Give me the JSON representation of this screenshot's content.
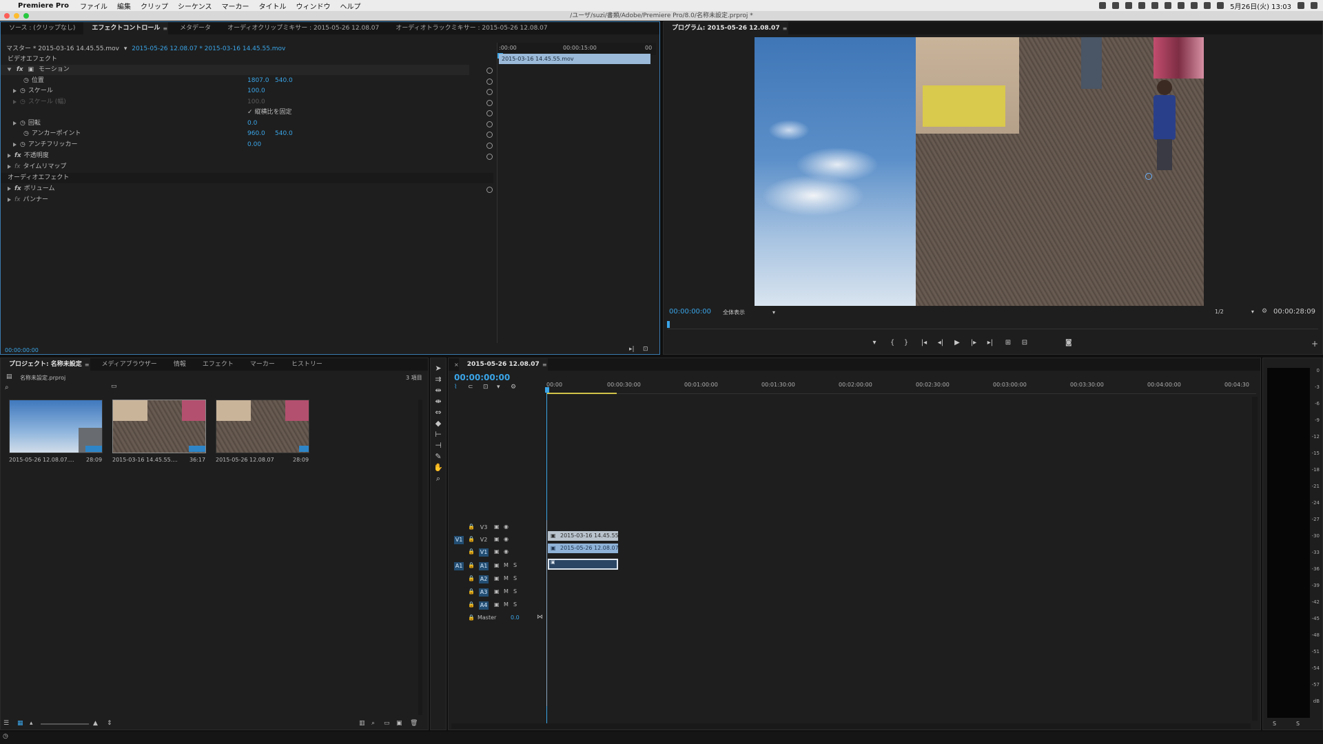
{
  "menubar": {
    "app": "Premiere Pro",
    "items": [
      "ファイル",
      "編集",
      "クリップ",
      "シーケンス",
      "マーカー",
      "タイトル",
      "ウィンドウ",
      "ヘルプ"
    ],
    "clock": "5月26日(火) 13:03"
  },
  "window": {
    "title": "/ユーザ/suzi/書類/Adobe/Premiere Pro/8.0/名称未設定.prproj *"
  },
  "source_panel": {
    "tabs": [
      "ソース : (クリップなし)",
      "エフェクトコントロール",
      "メタデータ",
      "オーディオクリップミキサー : 2015-05-26 12.08.07",
      "オーディオトラックミキサー : 2015-05-26 12.08.07"
    ],
    "active_tab": 1,
    "master_label": "マスター * 2015-03-16 14.45.55.mov",
    "sequence_clip": "2015-05-26 12.08.07 * 2015-03-16 14.45.55.mov",
    "video_effects_header": "ビデオエフェクト",
    "motion": "モーション",
    "position_label": "位置",
    "position_x": "1807.0",
    "position_y": "540.0",
    "scale_label": "スケール",
    "scale_value": "100.0",
    "scale_width_label": "スケール (幅)",
    "scale_width_value": "100.0",
    "uniform_scale": "縦横比を固定",
    "rotation_label": "回転",
    "rotation_value": "0.0",
    "anchor_label": "アンカーポイント",
    "anchor_x": "960.0",
    "anchor_y": "540.0",
    "flicker_label": "アンチフリッカー",
    "flicker_value": "0.00",
    "opacity": "不透明度",
    "time_remap": "タイムリマップ",
    "audio_effects_header": "オーディオエフェクト",
    "volume": "ボリューム",
    "panner": "パンナー",
    "timecode": "00:00:00:00",
    "mini_timeline_start": ":00:00",
    "mini_timeline_mid": "00:00:15:00",
    "mini_timeline_end": "00",
    "mini_clip": "2015-03-16 14.45.55.mov"
  },
  "program_panel": {
    "title": "プログラム: 2015-05-26 12.08.07",
    "timecode_left": "00:00:00:00",
    "fit": "全体表示",
    "resolution": "1/2",
    "timecode_right": "00:00:28:09"
  },
  "project_panel": {
    "tabs": [
      "プロジェクト: 名称未設定",
      "メディアブラウザー",
      "情報",
      "エフェクト",
      "マーカー",
      "ヒストリー"
    ],
    "project_file": "名称未設定.prproj",
    "item_count": "3 項目",
    "items": [
      {
        "name": "2015-05-26 12.08.07....",
        "duration": "28:09"
      },
      {
        "name": "2015-03-16 14.45.55....",
        "duration": "36:17"
      },
      {
        "name": "2015-05-26 12.08.07",
        "duration": "28:09"
      }
    ]
  },
  "timeline_panel": {
    "title": "2015-05-26 12.08.07",
    "timecode": "00:00:00:00",
    "ruler": [
      "00:00",
      "00:00:30:00",
      "00:01:00:00",
      "00:01:30:00",
      "00:02:00:00",
      "00:02:30:00",
      "00:03:00:00",
      "00:03:30:00",
      "00:04:00:00",
      "00:04:30"
    ],
    "tracks": [
      {
        "name": "V3",
        "src": "",
        "kind": "video"
      },
      {
        "name": "V2",
        "src": "V1",
        "kind": "video"
      },
      {
        "name": "V1",
        "src": "",
        "kind": "video"
      },
      {
        "name": "A1",
        "src": "A1",
        "kind": "audio"
      },
      {
        "name": "A2",
        "src": "",
        "kind": "audio"
      },
      {
        "name": "A3",
        "src": "",
        "kind": "audio"
      },
      {
        "name": "A4",
        "src": "",
        "kind": "audio"
      }
    ],
    "master_label": "Master",
    "master_value": "0.0",
    "clip_v2": "2015-03-16 14.45.55",
    "clip_v1": "2015-05-26 12.08.07",
    "mute": "M",
    "solo": "S"
  },
  "audio_meter": {
    "scale": [
      "0",
      "-3",
      "-6",
      "-9",
      "-12",
      "-15",
      "-18",
      "-21",
      "-24",
      "-27",
      "-30",
      "-33",
      "-36",
      "-39",
      "-42",
      "-45",
      "-48",
      "-51",
      "-54",
      "-57",
      "dB"
    ],
    "footer": [
      "S",
      "S"
    ]
  },
  "colors": {
    "accent": "#3aa5e8",
    "panel": "#1e1e1e",
    "clip_video": "#8fb3d8"
  }
}
